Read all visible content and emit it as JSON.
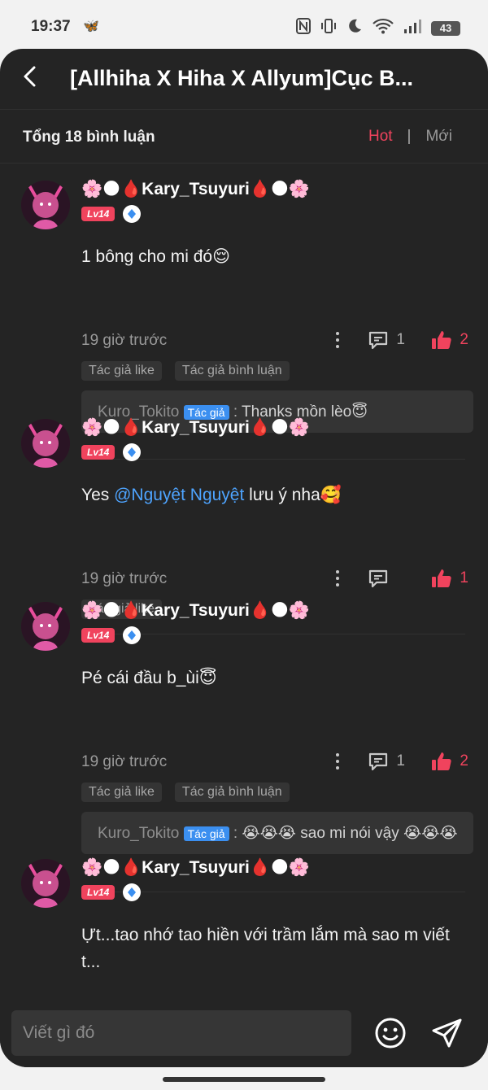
{
  "status_bar": {
    "time": "19:37",
    "battery": "43",
    "icons": [
      "app-notification-icon",
      "nfc-icon",
      "vibrate-icon",
      "dnd-moon-icon",
      "wifi-icon",
      "signal-icon",
      "battery-icon"
    ]
  },
  "header": {
    "title": "[Allhiha X Hiha X Allyum]Cục B...",
    "back_icon": "back-arrow-icon"
  },
  "summary": {
    "count_label": "Tổng 18 bình luận",
    "sort_hot": "Hot",
    "sort_sep": "|",
    "sort_new": "Mới"
  },
  "colors": {
    "accent": "#f0435d",
    "mention": "#4ea4ff",
    "background": "#242424",
    "status_bar": "#f2f2f2"
  },
  "comments": [
    {
      "username": "🌸🌑🩸Kary_Tsuyuri🩸🌑🌸",
      "level": "Lv14",
      "text": "1 bông cho mi đó😌",
      "time": "19 giờ trước",
      "reply_count": "1",
      "like_count": "2",
      "tags": [
        "Tác giả like",
        "Tác giả bình luận"
      ],
      "author_reply": {
        "author": "Kuro_Tokito",
        "badge": "Tác giả",
        "sep": " : ",
        "text": "Thanks mồn lèo😇"
      }
    },
    {
      "username": "🌸🌑🩸Kary_Tsuyuri🩸🌑🌸",
      "level": "Lv14",
      "text_before": "Yes ",
      "mention": "@Nguyệt Nguyệt",
      "text_after": "  lưu ý nha🥰",
      "time": "19 giờ trước",
      "reply_count": "",
      "like_count": "1",
      "tags": [
        "Tác giả like"
      ]
    },
    {
      "username": "🌸🌑🩸Kary_Tsuyuri🩸🌑🌸",
      "level": "Lv14",
      "text": "Pé cái đầu b_ùi😇",
      "time": "19 giờ trước",
      "reply_count": "1",
      "like_count": "2",
      "tags": [
        "Tác giả like",
        "Tác giả bình luận"
      ],
      "author_reply": {
        "author": "Kuro_Tokito",
        "badge": "Tác giả",
        "sep": " : ",
        "text": "😭😭😭 sao mi nói vậy 😭😭😭"
      }
    },
    {
      "username": "🌸🌑🩸Kary_Tsuyuri🩸🌑🌸",
      "level": "Lv14",
      "text": "Ựt...tao nhớ tao hiền với trầm lắm mà sao m viết t..."
    }
  ],
  "composer": {
    "placeholder": "Viết gì đó",
    "emoji_icon": "smiley-icon",
    "send_icon": "send-paper-plane-icon"
  }
}
